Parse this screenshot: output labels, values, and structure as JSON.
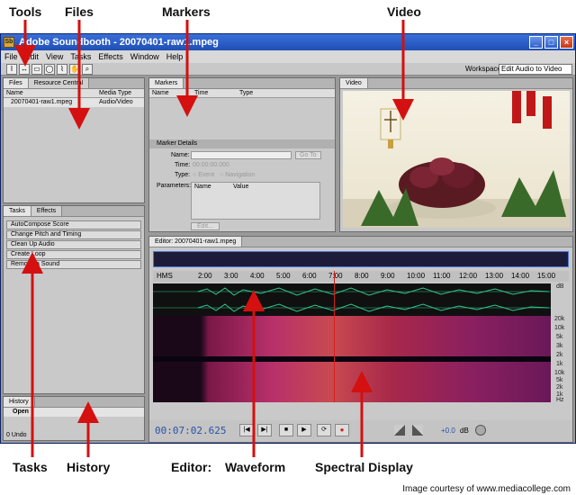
{
  "callouts": {
    "tools": "Tools",
    "files": "Files",
    "markers": "Markers",
    "video": "Video",
    "tasks": "Tasks",
    "history": "History",
    "editor": "Editor:",
    "waveform": "Waveform",
    "spectral": "Spectral Display"
  },
  "credit": "Image courtesy of www.mediacollege.com",
  "window": {
    "title": "Adobe Soundbooth - 20070401-raw1.mpeg",
    "menu": [
      "File",
      "Edit",
      "View",
      "Tasks",
      "Effects",
      "Window",
      "Help"
    ],
    "workspace_label": "Workspace:",
    "workspace_value": "Edit Audio to Video"
  },
  "files_panel": {
    "tabs": [
      "Files",
      "Resource Central"
    ],
    "columns": [
      "Name",
      "Media Type"
    ],
    "rows": [
      {
        "name": "20070401-raw1.mpeg",
        "type": "Audio/Video"
      }
    ]
  },
  "markers_panel": {
    "tab": "Markers",
    "columns": [
      "Name",
      "Time",
      "Type"
    ],
    "details_title": "Marker Details",
    "name_label": "Name:",
    "time_label": "Time:",
    "time_value": "00:00:00.000",
    "goto_label": "Go To",
    "type_label": "Type:",
    "type_event": "Event",
    "type_navigation": "Navigation",
    "params_label": "Parameters:",
    "params_columns": [
      "Name",
      "Value"
    ],
    "edit_label": "Edit..."
  },
  "video_panel": {
    "tab": "Video"
  },
  "tasks_panel": {
    "tabs": [
      "Tasks",
      "Effects"
    ],
    "buttons": [
      "AutoCompose Score",
      "Change Pitch and Timing",
      "Clean Up Audio",
      "Create Loop",
      "Remove a Sound"
    ]
  },
  "history_panel": {
    "tab": "History",
    "item": "Open",
    "undo": "0 Undo"
  },
  "editor_panel": {
    "tab": "Editor: 20070401-raw1.mpeg",
    "ruler_start": "HMS",
    "ruler_ticks": [
      "2:00",
      "3:00",
      "4:00",
      "5:00",
      "6:00",
      "7:00",
      "8:00",
      "9:00",
      "10:00",
      "11:00",
      "12:00",
      "13:00",
      "14:00",
      "15:00"
    ],
    "db_label": "dB",
    "hz_scale_top": [
      "20k",
      "10k",
      "5k",
      "3k",
      "2k",
      "1k"
    ],
    "hz_scale_bottom": [
      "10k",
      "5k",
      "2k",
      "1k",
      "Hz"
    ],
    "timecode": "00:07:02.625",
    "volume": "+0.0",
    "volume_unit": "dB"
  },
  "colors": {
    "spectral": "#b8306a",
    "waveform": "#34c48a",
    "playhead": "#d62020",
    "timecode": "#2a52a8"
  }
}
